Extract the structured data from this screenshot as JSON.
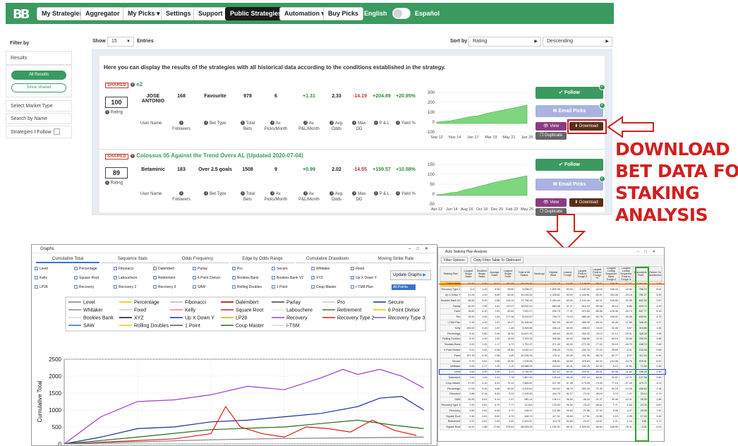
{
  "nav": {
    "logo": "BB",
    "items": [
      "My Strategies",
      "Aggregator",
      "My Picks ▾",
      "Settings",
      "Support",
      "Public Strategies",
      "Automation ▾",
      "Buy Picks"
    ],
    "active": "Public Strategies",
    "lang_left": "English",
    "lang_right": "Español"
  },
  "sidebar": {
    "title": "Filter by",
    "results_label": "Results",
    "all_results": "All Results",
    "since_shared": "Since shared",
    "market_type": "Select Market Type",
    "search": "Search by Name",
    "follow": "Strategies I Follow"
  },
  "controls": {
    "show": "Show",
    "show_value": "15",
    "entries": "Entries",
    "sort_by": "Sort by",
    "sort_value": "Rating",
    "order_value": "Descending"
  },
  "intro": "Here you can display the results of the strategies with all historical data according to the conditions established in the strategy.",
  "stat_labels": [
    "User Name",
    "Followers",
    "Bet Type",
    "Total Bets",
    "Av. Picks/Month",
    "Av. P&L/Month",
    "Avg. Odds",
    "Max DD",
    "P & L",
    "Yield %"
  ],
  "strategies": [
    {
      "shared": "SHARED",
      "title": "e2",
      "rating": "100",
      "rating_label": "Rating",
      "user": "JOSE ANTONIO",
      "followers": "168",
      "bet_type": "Favourite",
      "total_bets": "978",
      "picks_month": "6",
      "pl_month": "+1.31",
      "avg_odds": "2.33",
      "max_dd": "-14.19",
      "pl": "+204.89",
      "yield": "+20.95%",
      "spark_y": [
        "300",
        "200",
        "100",
        "0",
        "-100"
      ],
      "spark_x": [
        "Sep 12",
        "Nov 14",
        "Jan 17",
        "Mar 19",
        "May 21",
        "Jun 25"
      ],
      "follow": "Follow",
      "email": "Email Picks",
      "view": "View",
      "download": "Download",
      "duplicate": "Duplicate"
    },
    {
      "shared": "SHARED",
      "title": "Colossus 05 Against the Trend Overs AL (Updated 2020-07-04)",
      "rating": "89",
      "rating_label": "Rating",
      "user": "Betaminic",
      "followers": "183",
      "bet_type": "Over 2.5 goals",
      "total_bets": "1508",
      "picks_month": "9",
      "pl_month": "+0.99",
      "avg_odds": "2.02",
      "max_dd": "-14.55",
      "pl": "+159.57",
      "yield": "+10.58%",
      "spark_y": [
        "150",
        "100",
        "50",
        "0",
        "-50"
      ],
      "spark_x": [
        "Apr 12",
        "Jun 14",
        "Aug 16",
        "Oct 18",
        "Dec 20",
        "Feb 23",
        "May 25"
      ],
      "follow": "Follow",
      "email": "Email Picks",
      "view": "View",
      "download": "Download",
      "duplicate": "Duplicate"
    }
  ],
  "annotation": [
    "DOWNLOAD",
    "BET DATA FOR",
    "STAKING",
    "ANALYSIS"
  ],
  "graphs_window": {
    "title": "Graphs",
    "tabs": [
      "Cumulative Total",
      "Sequence Stats",
      "Odds Frequency",
      "Edge by Odds Range",
      "Cumulative Drawdown",
      "Moving Strike Rate"
    ],
    "checkboxes": [
      [
        "Level",
        "Percentage",
        "Fibonacci",
        "Dalembert",
        "Parlay",
        "Pro",
        "Secure",
        "Whitaker",
        "Fixed"
      ],
      [
        "Kelly",
        "Square Root",
        "Labouchere",
        "Retirement",
        "6 Point Divisor",
        "Bookies Bank",
        "Bookies Bank V2",
        "XYZ",
        "Up X Down Y"
      ],
      [
        "LP28",
        "Recovery",
        "Recovery 2",
        "Recovery 3",
        "SAW",
        "Rolling Doubles",
        "1 Point",
        "Coup Master",
        "i-TSM Plan"
      ]
    ],
    "update": "Update Graphs",
    "select_value": "All Points"
  },
  "chart_data": {
    "type": "line",
    "title": "",
    "xlabel": "Bet Number",
    "ylabel": "Cumulative Total",
    "xlim": [
      0,
      5000
    ],
    "ylim": [
      0,
      2500
    ],
    "xticks": [
      1000,
      2000,
      3000,
      4000
    ],
    "yticks": [
      0,
      500,
      1000,
      1500,
      2000,
      2500
    ],
    "legend_position": "top",
    "legend": [
      {
        "name": "Level",
        "color": "#7f7f7f"
      },
      {
        "name": "Percentage",
        "color": "#e6c200"
      },
      {
        "name": "Fibonacci",
        "color": "#b8b8b8"
      },
      {
        "name": "Dalembert",
        "color": "#8b0000"
      },
      {
        "name": "Parlay",
        "color": "#3f3f3f"
      },
      {
        "name": "Pro",
        "color": "#c8c8c8"
      },
      {
        "name": "Secure",
        "color": "#1a2f9a"
      },
      {
        "name": "Whitaker",
        "color": "#8a8a8a"
      },
      {
        "name": "Fixed",
        "color": "#cfcfcf"
      },
      {
        "name": "Kelly",
        "color": "#e87fa0"
      },
      {
        "name": "Square Root",
        "color": "#cc2222"
      },
      {
        "name": "Labouchere",
        "color": "#e6e6e6"
      },
      {
        "name": "Retirement",
        "color": "#556b2f"
      },
      {
        "name": "6 Point Divisor",
        "color": "#e6c200"
      },
      {
        "name": "Bookies Bank",
        "color": "#d9d9d9"
      },
      {
        "name": "XYZ",
        "color": "#111111"
      },
      {
        "name": "Up X Down Y",
        "color": "#1a2f9a"
      },
      {
        "name": "LP28",
        "color": "#c9a800"
      },
      {
        "name": "Recovery",
        "color": "#9b3fcf"
      },
      {
        "name": "Recovery Type 2",
        "color": "#e11b1b"
      },
      {
        "name": "Recovery Type 3",
        "color": "#7b5fc0"
      },
      {
        "name": "SAW",
        "color": "#2f66cc"
      },
      {
        "name": "Rolling Doubles",
        "color": "#f0c800"
      },
      {
        "name": "1 Point",
        "color": "#555555"
      },
      {
        "name": "Coup Master",
        "color": "#2f6b1a"
      },
      {
        "name": "i-TSM",
        "color": "#dcdcdc"
      }
    ],
    "series": [
      {
        "name": "Recovery",
        "color": "#9b3fcf",
        "x": [
          0,
          500,
          1000,
          1500,
          2000,
          2500,
          3000,
          3500,
          3800,
          4000,
          4300,
          4600,
          4900
        ],
        "y": [
          0,
          800,
          1250,
          1300,
          1450,
          1700,
          1600,
          1950,
          2200,
          2050,
          2200,
          2000,
          1650
        ]
      },
      {
        "name": "Secure",
        "color": "#1a2f9a",
        "x": [
          0,
          500,
          1000,
          1500,
          2000,
          2500,
          3000,
          3500,
          4000,
          4300,
          4600,
          4900
        ],
        "y": [
          0,
          200,
          450,
          500,
          650,
          700,
          800,
          900,
          1100,
          1350,
          1400,
          1000
        ]
      },
      {
        "name": "Recovery Type 2",
        "color": "#e11b1b",
        "x": [
          0,
          1500,
          2000,
          2200,
          2400,
          2700,
          3000,
          3300,
          3600,
          3900,
          4200,
          4500,
          4800
        ],
        "y": [
          0,
          150,
          300,
          1100,
          500,
          300,
          200,
          500,
          450,
          350,
          700,
          400,
          250
        ]
      },
      {
        "name": "Coup Master",
        "color": "#2f6b1a",
        "x": [
          0,
          1000,
          2000,
          3000,
          3500,
          4000,
          4500,
          4900
        ],
        "y": [
          0,
          200,
          420,
          500,
          600,
          700,
          550,
          450
        ]
      },
      {
        "name": "Level",
        "color": "#7f7f7f",
        "x": [
          0,
          1000,
          2000,
          3000,
          4000,
          4900
        ],
        "y": [
          0,
          60,
          120,
          160,
          180,
          200
        ]
      }
    ]
  },
  "staking_window": {
    "title": "Auto Staking Plan Analysis",
    "tools": [
      "Filter Options",
      "Copy Filter Table To Clipboard"
    ],
    "columns": [
      "Staking Plan",
      "Longest Single Stake",
      "Smallest Single Stake",
      "Average Stake",
      "Largest Single Profit",
      "Total of All Stakes",
      "Bankrupt",
      "Highest Bank",
      "Lowest Trough",
      "Largest Peak to Trough £",
      "Largest Peak to Trough %",
      "Longest Losing Sequence Bank Trough £",
      "Longest Losing Sequence Peak to Trough %",
      "Cumulative Profit",
      "Return On Investment"
    ],
    "rows": [
      [
        "Labouchere",
        "22.00",
        "4.00",
        "19.11",
        "182.59",
        "54,618.44",
        "",
        "2,302.26",
        "10.00",
        "-1,148.09",
        "-89.07",
        "306.06",
        "-17.87",
        "1,862.65",
        "3.39"
      ],
      [
        "Recovery Type 2",
        "11.0",
        "1.00",
        "8.90",
        "99.80",
        "9,098.07",
        "",
        "1,800.98",
        "50.00",
        "-1,182.90",
        "-44.16",
        "168.44",
        "-23.50",
        "786.19",
        "8.64"
      ],
      [
        "Up X Down Y",
        "21.00",
        "1.00",
        "8.89",
        "80.40",
        "14,240.53",
        "",
        "1,328.61",
        "50.00",
        "-1,440.61",
        "-50.37",
        "263.06",
        "-20.18",
        "781.27",
        "5.49"
      ],
      [
        "Bookies Bank V2",
        "48.59",
        "5.00",
        "9.85",
        "128.13",
        "12,738.34",
        "",
        "1,254.44",
        "60.00",
        "-1,104.44",
        "-62.11",
        "109.65",
        "-20.05",
        "632.30",
        "3.87"
      ],
      [
        "Parlay",
        "40.00",
        "2.50",
        "4.61",
        "123.37",
        "18,610.43",
        "",
        "863.48",
        "47.27",
        "-616.16",
        "-95.08",
        "48.14",
        "-8.86",
        "633.70",
        "3.39"
      ],
      [
        "Fixed",
        "16.60",
        "6.10",
        "1.61",
        "82.64",
        "7,991.27",
        "",
        "930.75",
        "77.21",
        "-470.53",
        "-86.56",
        "128.36",
        "-40.73",
        "647.77",
        "8.19"
      ],
      [
        "Pro",
        "18.00",
        "1.00",
        "1.81",
        "177.08",
        "8,919.57",
        "",
        "709.73",
        "74.10",
        "-680.45",
        "-90.78",
        "106.02",
        "-40.45",
        "630.61",
        "4.73"
      ],
      [
        "i-TSM Plan",
        "2.26",
        "1.00",
        "1.67",
        "15.07",
        "15,168.46",
        "",
        "567.95",
        "60.00",
        "-489.05",
        "-65.44",
        "40.38",
        "-12.58",
        "346.09",
        "2.37"
      ],
      [
        "Kelly",
        "150.00",
        "6.15",
        "1.87",
        "1.46",
        "6,359.58",
        "",
        "456.18",
        "60.00",
        "-398.52",
        "-78.22",
        "32.38",
        "-5.87",
        "316.86",
        "2.06"
      ],
      [
        "Percentage",
        "4.14",
        "0.80",
        "0.49",
        "36.30",
        "10,837.29",
        "",
        "453.62",
        "60.00",
        "-352.02",
        "-78.10",
        "21.12",
        "-25.01",
        "328.38",
        "1.99"
      ],
      [
        "Rolling Doubles",
        "5.32",
        "1.00",
        "1.52",
        "15.93",
        "7,323.33",
        "",
        "398.68",
        "60.00",
        "-288.89",
        "-76.43",
        "69.19",
        "-26.68",
        "335.25",
        "2.86"
      ],
      [
        "Bookies Bank",
        "3.00",
        "1.00",
        "1.17",
        "6.73",
        "1,751.57",
        "",
        "371.26",
        "60.00",
        "-271.26",
        "-77.02",
        "30.19",
        "-18.70",
        "188.74",
        "2.68"
      ],
      [
        "6 Point Divisor",
        "4.41",
        "0.52",
        "0.98",
        "26.60",
        "4,040.12",
        "",
        "236.25",
        "70.00",
        "-200.76",
        "-71.24",
        "25.69",
        "-9.91",
        "153.28",
        "0.88"
      ],
      [
        "Fixed",
        "157.78",
        "6.15",
        "2.58",
        "4.80",
        "10,335.24",
        "",
        "176.11",
        "60.00",
        "-111.96",
        "-86.76",
        "82.77",
        "-8.97",
        "117.04",
        "6.44"
      ],
      [
        "Secure",
        "5.70",
        "0.51",
        "0.68",
        "15.30",
        "7,228.96",
        "",
        "936.61",
        "53.60",
        "-378.63",
        "-82.22",
        "154.96",
        "-24.76",
        "876.61",
        "8.91"
      ],
      [
        "Whitaker",
        "3.06",
        "0.17",
        "1.20",
        "2.15",
        "10,688.03",
        "",
        "224.64",
        "60.41",
        "-100.25",
        "-52.34",
        "5.13",
        "-11.51",
        "73.50",
        "0.30"
      ],
      [
        "Level",
        "1.00",
        "1.00",
        "1.00",
        "1.21",
        "9,748.00",
        "",
        "327.67",
        "60.00",
        "-200.01",
        "-65.01",
        "60.08",
        "-11.62",
        "156.33",
        "2.40"
      ],
      [
        "Dalembert",
        "7.00",
        "1.00",
        "1.41",
        "7.76",
        "7,887.00",
        "",
        "135.18",
        "99.40",
        "-237.10",
        "-68.51",
        "32.67",
        "-22.71",
        "127.06",
        "0.60"
      ],
      [
        "Coup Master",
        "27.00",
        "4.10",
        "8.41",
        "73.12",
        "7,865.42",
        "",
        "227.99",
        "57.28",
        "-173.05",
        "-74.30",
        "77.15",
        "-27.25",
        "479.71",
        "4.23"
      ],
      [
        "Percentage",
        "17.04",
        "6.15",
        "9.80",
        "69.42",
        "4,425.61",
        "",
        "404.02",
        "96.79",
        "-300.44",
        "-71.40",
        "40.18",
        "-12.05",
        "338.63",
        "2.18"
      ],
      [
        "Fibonacci",
        "2.86",
        "6.15",
        "8.43",
        "6.22",
        "2,100.40",
        "",
        "404.79",
        "82.27",
        "-70.42",
        "-48.19",
        "9.74",
        "-7.07",
        "33.14",
        "4.79"
      ],
      [
        "SAW",
        "26.26",
        "6.61",
        "6.19",
        "2.47",
        "960.14",
        "",
        "146.14",
        "96.50",
        "-46.24",
        "-31.37",
        "39.46",
        "-10.31",
        "28.28",
        "2.86"
      ],
      [
        "Recovery Type 3",
        "1.00",
        "0.61",
        "6.70",
        "7.77",
        "10,303",
        "",
        "123.63",
        "96.50",
        "-75.22",
        "-56.61",
        "7.71",
        "-2.65",
        "23.76",
        "6.87"
      ],
      [
        "Recovery",
        "3.60",
        "0.61",
        "6.63",
        "6.72",
        "208.61",
        "",
        "121.66",
        "95.60",
        "-21.86",
        "-47.32",
        "9.06",
        "-3.07",
        "20.08",
        "7.51"
      ],
      [
        "Square Root",
        "2.46",
        "0.61",
        "8.60",
        "6.70",
        "448.13",
        "",
        "117.01",
        "95.60",
        "-17.51",
        "-32.80",
        "4.19",
        "-2.08",
        "17.02",
        "3.46"
      ],
      [
        "Retirement",
        "3.31",
        "0.61",
        "0.83",
        "9.52",
        "2,001.61",
        "",
        "113.78",
        "84.60",
        "-23.37",
        "-18.67",
        "1.21",
        "-1.16",
        "5.81",
        "2.71"
      ],
      [
        "Square Root",
        "14.91",
        "1.66",
        "17.69",
        "276.61",
        "88,528.29",
        "",
        "1,190.91",
        "89.11",
        "-1,029.93",
        "-86.64",
        "169.99",
        "-26.11",
        "-3.21",
        "-0.01"
      ]
    ]
  }
}
